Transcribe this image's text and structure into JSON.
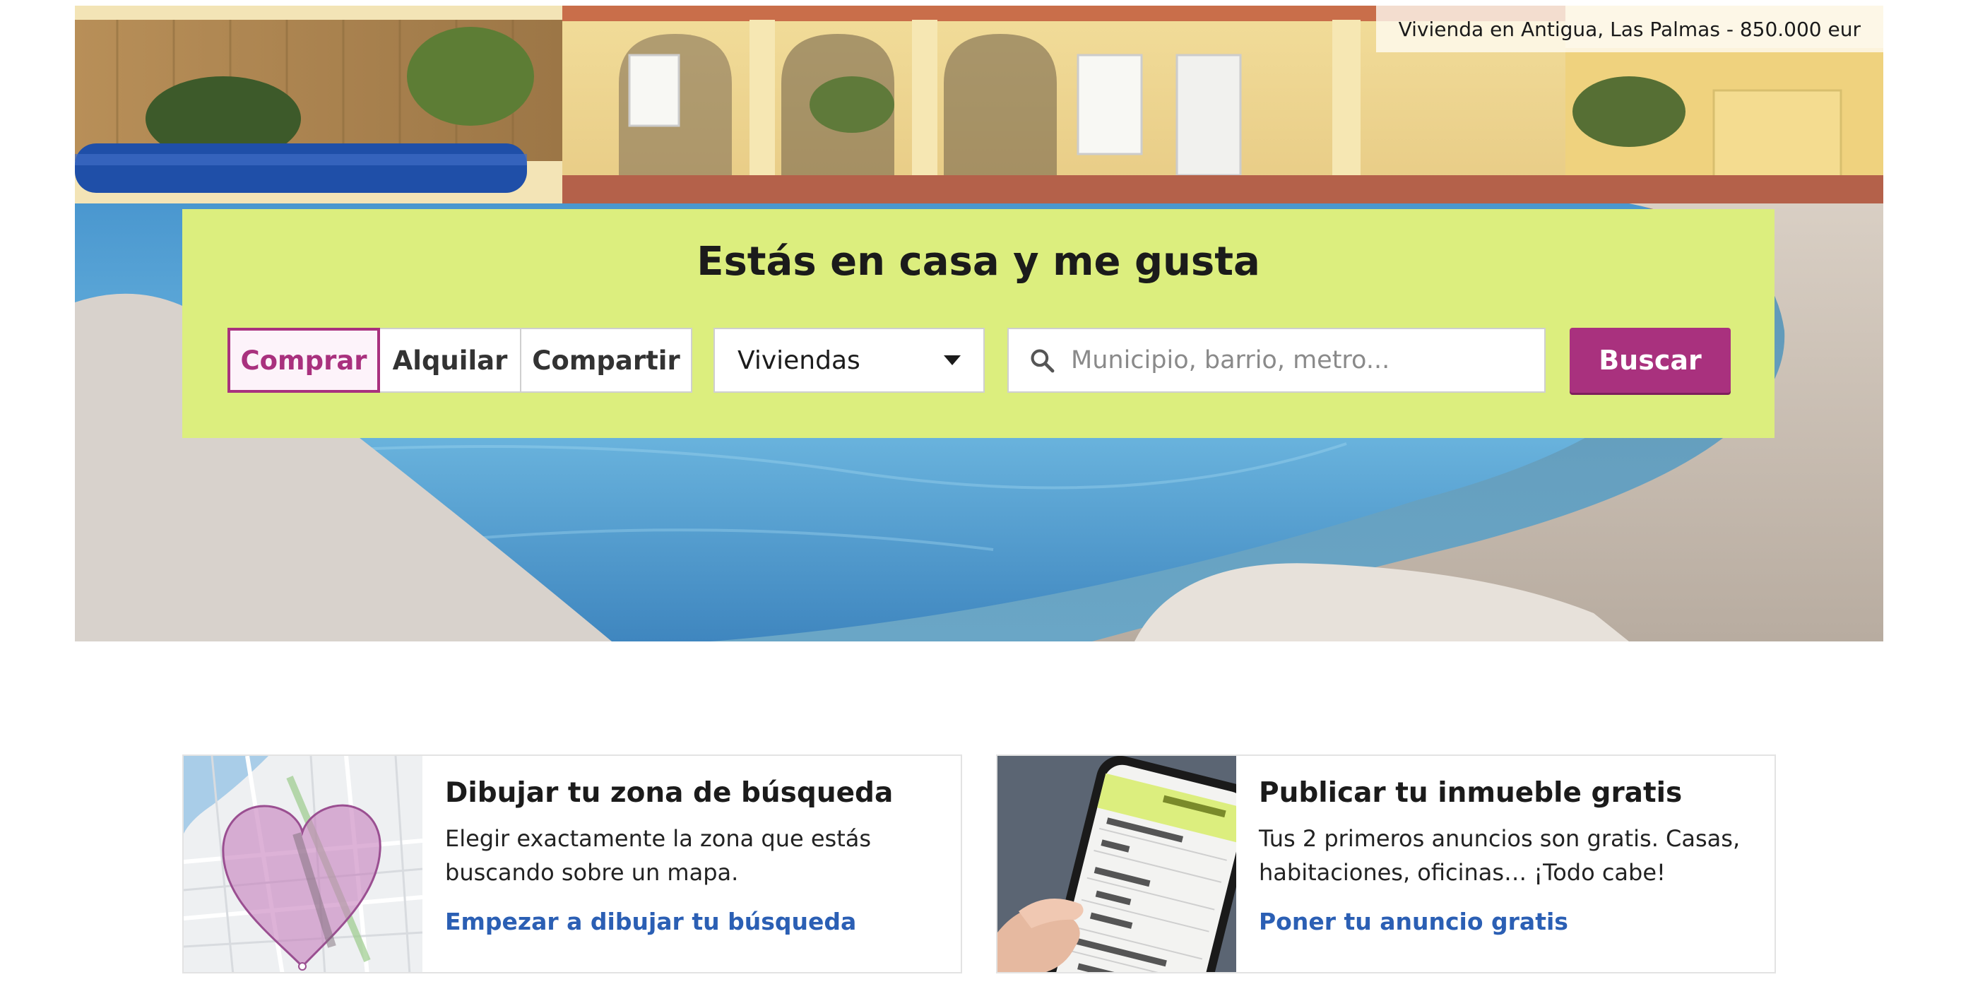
{
  "hero": {
    "caption": "Vivienda en Antigua, Las Palmas - 850.000 eur"
  },
  "search": {
    "headline": "Estás en casa y me gusta",
    "operations": [
      "Comprar",
      "Alquilar",
      "Compartir"
    ],
    "active_operation": "Comprar",
    "property_type": "Viviendas",
    "location_placeholder": "Municipio, barrio, metro...",
    "submit_label": "Buscar"
  },
  "cards": [
    {
      "title": "Dibujar tu zona de búsqueda",
      "text": "Elegir exactamente la zona que estás buscando sobre un mapa.",
      "link": "Empezar a dibujar tu búsqueda"
    },
    {
      "title": "Publicar tu inmueble gratis",
      "text": "Tus 2 primeros anuncios son gratis. Casas, habitaciones, oficinas… ¡Todo cabe!",
      "link": "Poner tu anuncio gratis"
    }
  ],
  "colors": {
    "accent": "#a9317e",
    "panel": "#dcee7e",
    "link": "#2b5fb4"
  }
}
